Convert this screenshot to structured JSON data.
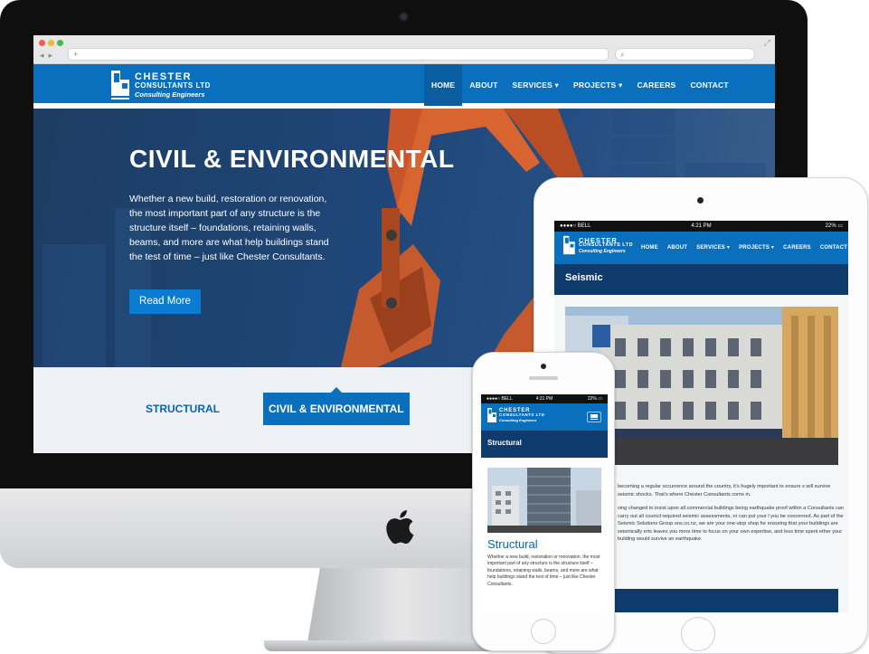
{
  "colors": {
    "brand_blue": "#0a70bd",
    "navy": "#0e3a6c",
    "hero_bg": "#1e4678"
  },
  "desktop": {
    "brand": {
      "name": "CHESTER",
      "name2": "CONSULTANTS LTD",
      "tagline": "Consulting Engineers"
    },
    "nav": [
      "HOME",
      "ABOUT",
      "SERVICES",
      "PROJECTS",
      "CAREERS",
      "CONTACT"
    ],
    "active_nav": "HOME",
    "hero": {
      "title": "CIVIL & ENVIRONMENTAL",
      "text": "Whether a new build, restoration or renovation, the most important part of any structure is the structure itself – foundations, retaining walls, beams, and more are what help buildings stand the test of time – just like Chester Consultants.",
      "button": "Read More"
    },
    "tabs": [
      "STRUCTURAL",
      "CIVIL & ENVIRONMENTAL"
    ],
    "active_tab": "CIVIL & ENVIRONMENTAL"
  },
  "tablet": {
    "status": {
      "carrier": "BELL",
      "time": "4:21 PM",
      "battery": "22%"
    },
    "nav": [
      "HOME",
      "ABOUT",
      "SERVICES",
      "PROJECTS",
      "CAREERS",
      "CONTACT"
    ],
    "page_title": "Seismic",
    "para1": "becoming a regular occurrence around the country, it's hugely important to ensure s will survive seismic shocks. That's where Chester Consultants come in.",
    "para2": "ving changed to insist upon all commercial buildings being earthquake proof within a Consultants can carry out all council required seismic assessments, or can put your l you be concerned. As part of the Seismic Solutions Group ons.co.nz, we are your one-stop shop for ensuring that your buildings are seismically erts leaves you more time to focus on your own expertise, and less time spent ether your building would survive an earthquake."
  },
  "phone": {
    "status": {
      "carrier": "BELL",
      "time": "4:21 PM",
      "battery": "22%"
    },
    "page_title": "Structural",
    "heading": "Structural",
    "text": "Whether a new build, restoration or renovation, the most important part of any structure is the structure itself – foundations, retaining walls, beams, and more are what help buildings stand the test of time – just like Chester Consultants."
  }
}
